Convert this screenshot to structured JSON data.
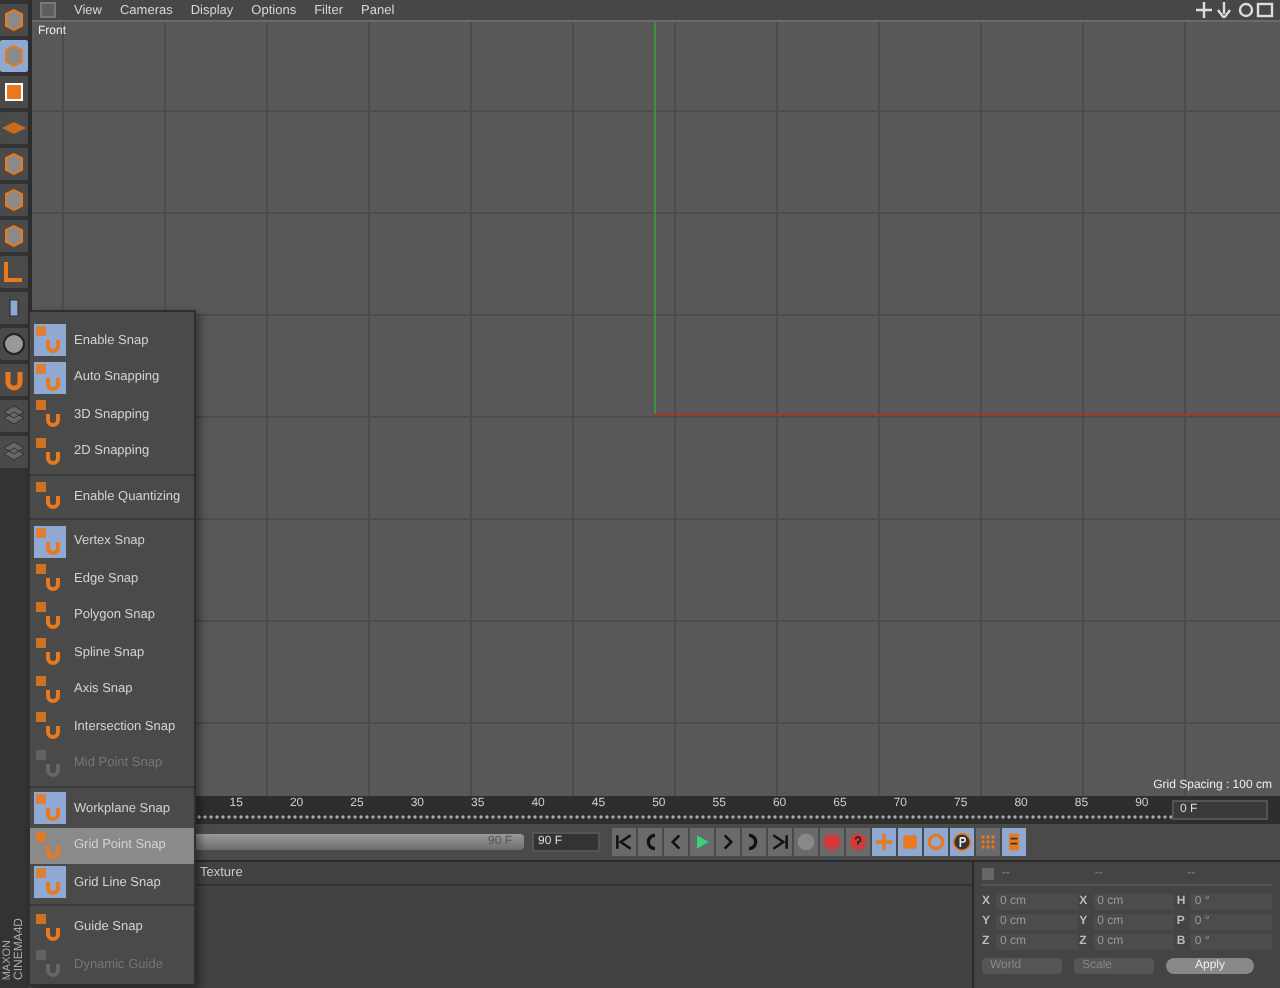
{
  "viewport": {
    "menu": [
      "View",
      "Cameras",
      "Display",
      "Options",
      "Filter",
      "Panel"
    ],
    "camera_label": "Front",
    "grid_spacing": "Grid Spacing : 100 cm"
  },
  "snap_menu": {
    "items": [
      {
        "kind": "item",
        "label": "Enable Snap",
        "checked": true,
        "selected": false,
        "disabled": false
      },
      {
        "kind": "item",
        "label": "Auto Snapping",
        "checked": true,
        "selected": false,
        "disabled": false
      },
      {
        "kind": "item",
        "label": "3D Snapping",
        "checked": false,
        "selected": false,
        "disabled": false
      },
      {
        "kind": "item",
        "label": "2D Snapping",
        "checked": false,
        "selected": false,
        "disabled": false
      },
      {
        "kind": "separator"
      },
      {
        "kind": "item",
        "label": "Enable Quantizing",
        "checked": false,
        "selected": false,
        "disabled": false
      },
      {
        "kind": "separator"
      },
      {
        "kind": "item",
        "label": "Vertex Snap",
        "checked": true,
        "selected": false,
        "disabled": false
      },
      {
        "kind": "item",
        "label": "Edge Snap",
        "checked": false,
        "selected": false,
        "disabled": false
      },
      {
        "kind": "item",
        "label": "Polygon Snap",
        "checked": false,
        "selected": false,
        "disabled": false
      },
      {
        "kind": "item",
        "label": "Spline Snap",
        "checked": false,
        "selected": false,
        "disabled": false
      },
      {
        "kind": "item",
        "label": "Axis Snap",
        "checked": false,
        "selected": false,
        "disabled": false
      },
      {
        "kind": "item",
        "label": "Intersection Snap",
        "checked": false,
        "selected": false,
        "disabled": false
      },
      {
        "kind": "item",
        "label": "Mid Point Snap",
        "checked": false,
        "selected": false,
        "disabled": true
      },
      {
        "kind": "separator"
      },
      {
        "kind": "item",
        "label": "Workplane Snap",
        "checked": true,
        "selected": false,
        "disabled": false
      },
      {
        "kind": "item",
        "label": "Grid Point Snap",
        "checked": false,
        "selected": true,
        "disabled": false
      },
      {
        "kind": "item",
        "label": "Grid Line Snap",
        "checked": true,
        "selected": false,
        "disabled": false
      },
      {
        "kind": "separator"
      },
      {
        "kind": "item",
        "label": "Guide Snap",
        "checked": false,
        "selected": false,
        "disabled": false
      },
      {
        "kind": "item",
        "label": "Dynamic Guide",
        "checked": false,
        "selected": false,
        "disabled": true
      }
    ]
  },
  "timeline": {
    "ticks": [
      "15",
      "20",
      "25",
      "30",
      "35",
      "40",
      "45",
      "50",
      "55",
      "60",
      "65",
      "70",
      "75",
      "80",
      "85",
      "90"
    ],
    "current_frame": "0 F",
    "range": {
      "label": "90 F",
      "level": 1
    },
    "max_frame": "90 F"
  },
  "attributes": {
    "tab": "Texture"
  },
  "coordinates": {
    "checked": false,
    "headers": [
      "--",
      "--",
      "--"
    ],
    "rows": [
      {
        "axis": "X",
        "value": "0 cm",
        "axis_2": "X",
        "value_2": "0 cm",
        "axis_3": "H",
        "value_3": "0 °"
      },
      {
        "axis": "Y",
        "value": "0 cm",
        "axis_2": "Y",
        "value_2": "0 cm",
        "axis_3": "P",
        "value_3": "0 °"
      },
      {
        "axis": "Z",
        "value": "0 cm",
        "axis_2": "Z",
        "value_2": "0 cm",
        "axis_3": "B",
        "value_3": "0 °"
      }
    ],
    "dropdowns": [
      "World",
      "Scale"
    ],
    "apply": "Apply"
  },
  "logo": {
    "maker": "MAXON",
    "product": "CINEMA4D"
  }
}
